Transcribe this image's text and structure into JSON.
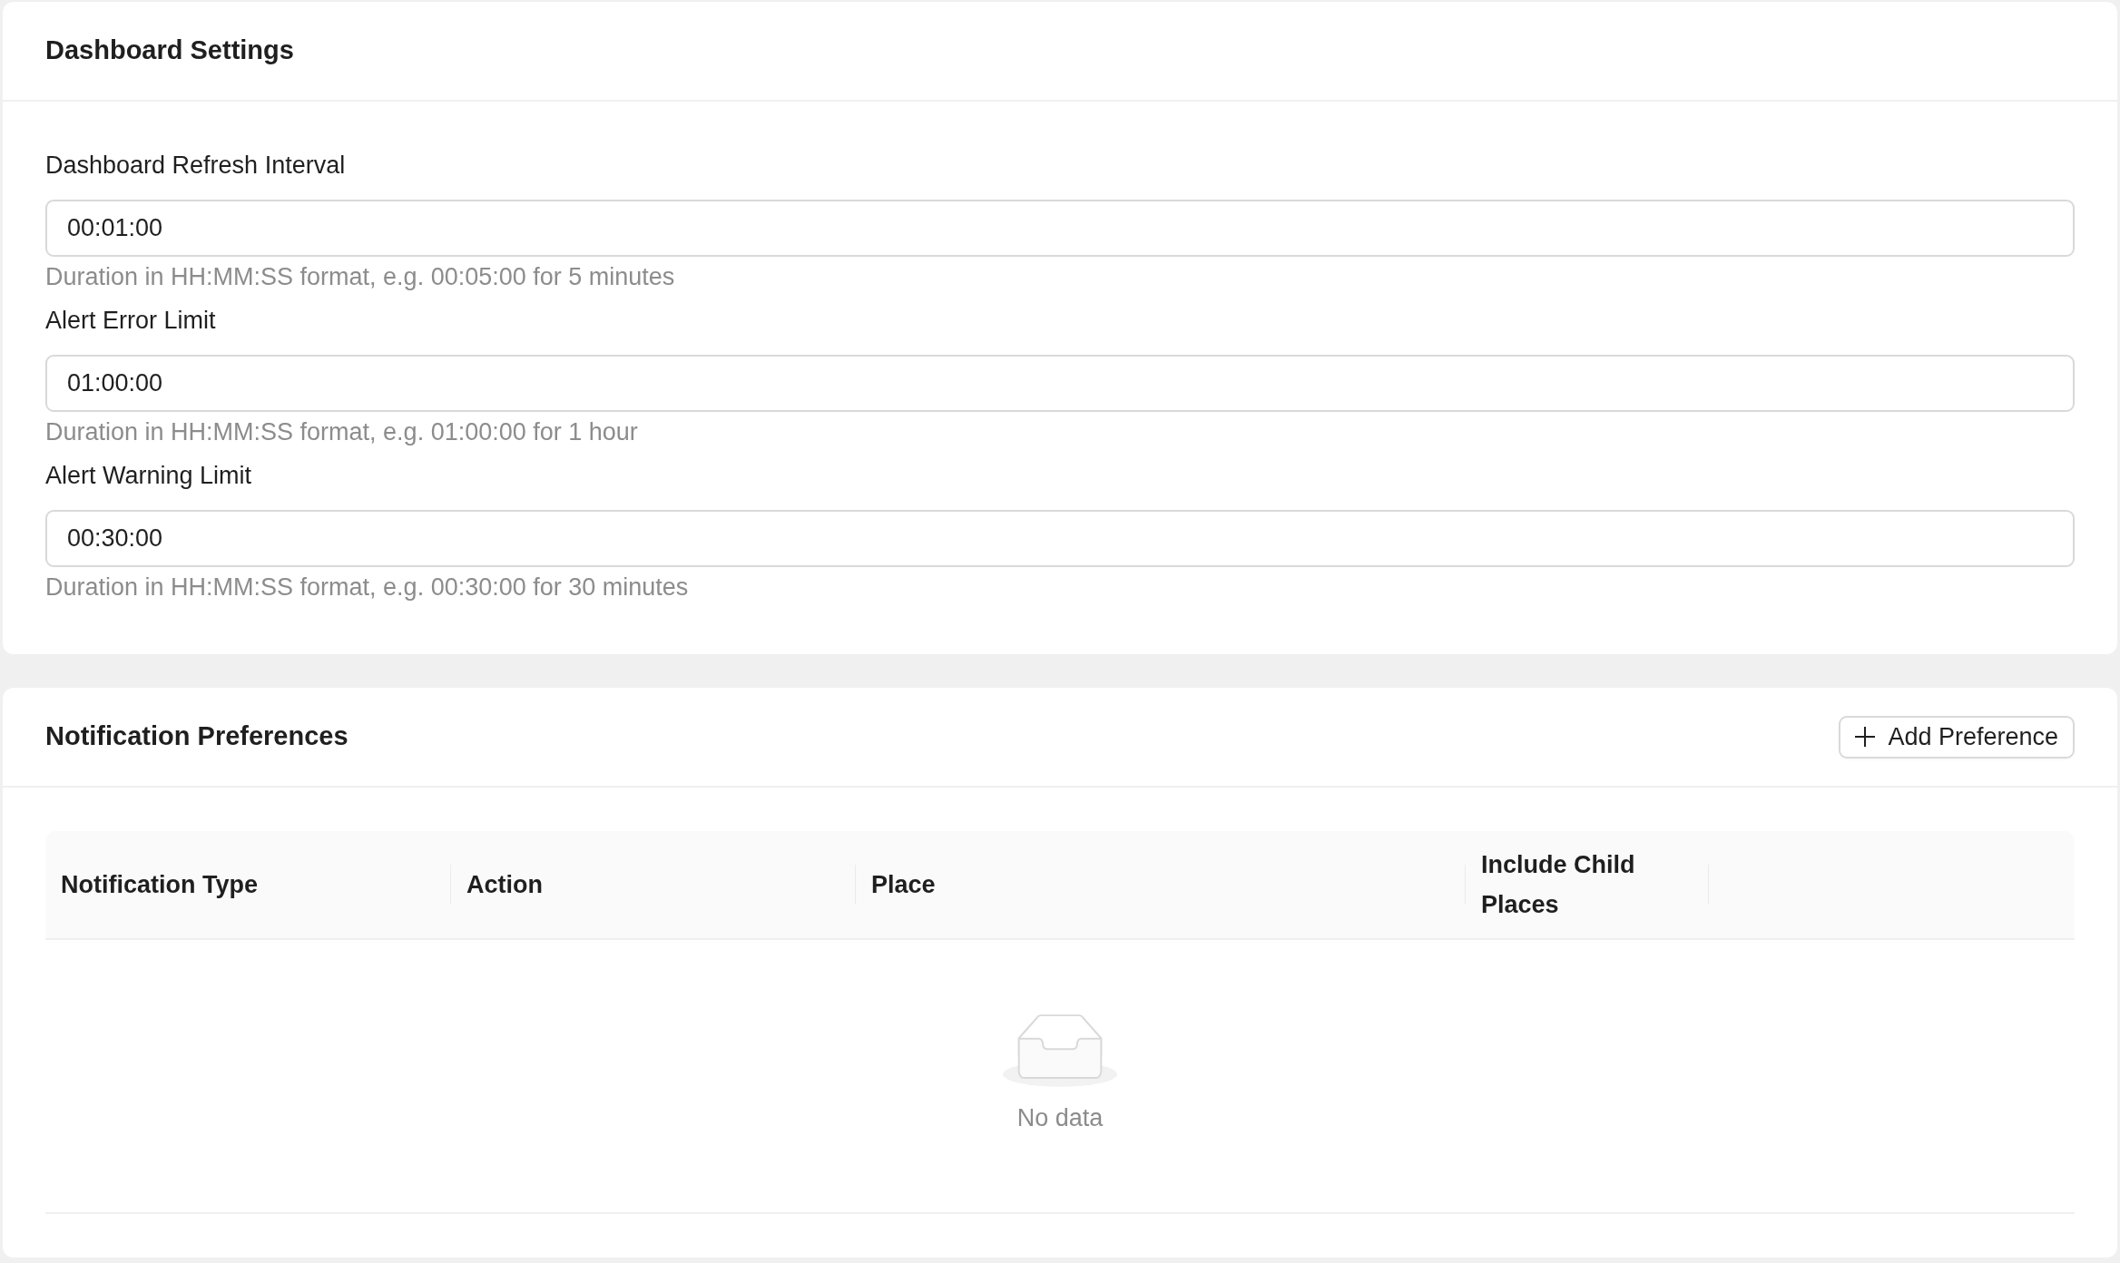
{
  "dashboard_settings": {
    "title": "Dashboard Settings",
    "fields": [
      {
        "label": "Dashboard Refresh Interval",
        "value": "00:01:00",
        "help": "Duration in HH:MM:SS format, e.g. 00:05:00 for 5 minutes"
      },
      {
        "label": "Alert Error Limit",
        "value": "01:00:00",
        "help": "Duration in HH:MM:SS format, e.g. 01:00:00 for 1 hour"
      },
      {
        "label": "Alert Warning Limit",
        "value": "00:30:00",
        "help": "Duration in HH:MM:SS format, e.g. 00:30:00 for 30 minutes"
      }
    ]
  },
  "notification_preferences": {
    "title": "Notification Preferences",
    "add_button": "Add Preference",
    "table": {
      "columns": [
        "Notification Type",
        "Action",
        "Place",
        "Include Child Places"
      ],
      "empty_text": "No data"
    }
  }
}
